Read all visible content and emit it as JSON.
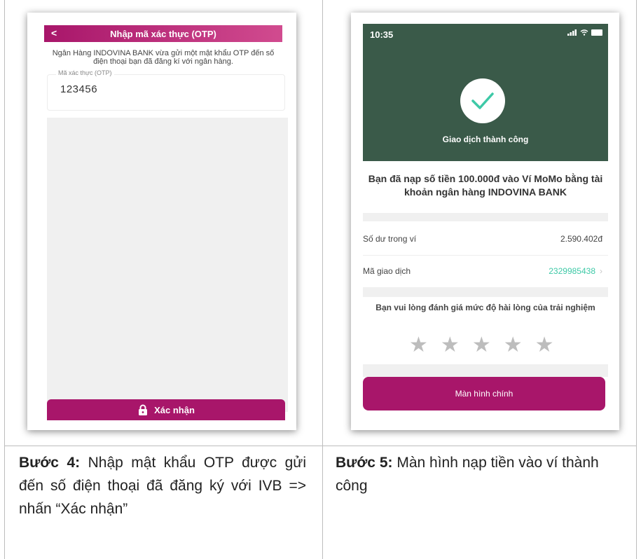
{
  "left_screen": {
    "header_back": "<",
    "header_title": "Nhập mã xác thực (OTP)",
    "message": "Ngân Hàng INDOVINA BANK vừa gửi một mật khẩu OTP đến số điện thoại bạn đã đăng kí với ngân hàng.",
    "otp_label": "Mã xác thực (OTP)",
    "otp_value": "123456",
    "confirm_label": "Xác nhận"
  },
  "right_screen": {
    "time": "10:35",
    "success_title": "Giao dịch thành công",
    "message": "Bạn đã nạp số tiền 100.000đ vào Ví MoMo bằng tài khoản ngân hàng INDOVINA BANK",
    "balance_label": "Số dư trong ví",
    "balance_value": "2.590.402đ",
    "txn_label": "Mã giao dịch",
    "txn_value": "2329985438",
    "rating_question": "Bạn vui lòng đánh giá mức độ hài lòng của trải nghiệm",
    "rating_stars": 5,
    "main_button": "Màn hình chính"
  },
  "captions": {
    "step4_label": "Bước 4:",
    "step4_text": " Nhập mật khẩu OTP được gửi đến số điện thoại đã đăng ký với IVB => nhấn “Xác nhận”",
    "step5_label": "Bước 5:",
    "step5_text": " Màn hình nạp tiền vào ví thành công"
  },
  "colors": {
    "momo_pink": "#a8166a",
    "success_green": "#3a5a49",
    "link_teal": "#3ec9a7",
    "star_gray": "#bdbdbd"
  }
}
